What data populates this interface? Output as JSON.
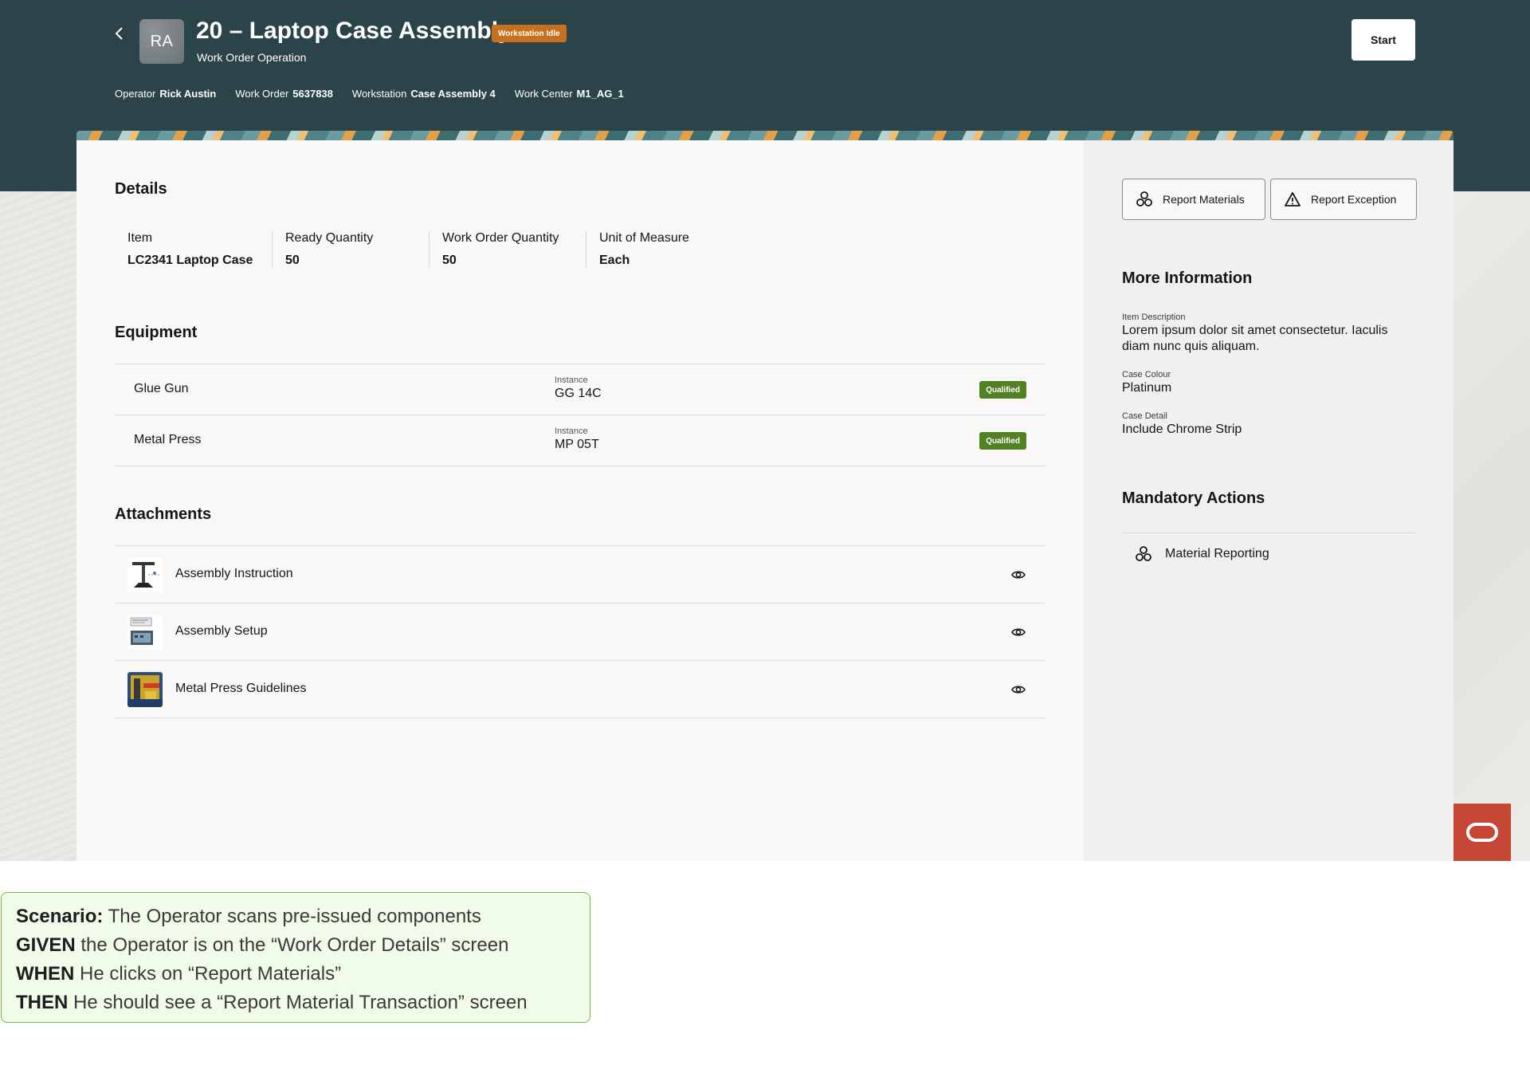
{
  "header": {
    "avatar_initials": "RA",
    "title": "20 – Laptop Case Assembly",
    "status_badge": "Workstation Idle",
    "subtitle": "Work Order Operation",
    "start_label": "Start",
    "meta": [
      {
        "label": "Operator",
        "value": "Rick Austin"
      },
      {
        "label": "Work Order",
        "value": "5637838"
      },
      {
        "label": "Workstation",
        "value": "Case Assembly 4"
      },
      {
        "label": "Work Center",
        "value": "M1_AG_1"
      }
    ]
  },
  "details": {
    "heading": "Details",
    "fields": [
      {
        "label": "Item",
        "value": "LC2341 Laptop Case"
      },
      {
        "label": "Ready Quantity",
        "value": "50"
      },
      {
        "label": "Work Order Quantity",
        "value": "50"
      },
      {
        "label": "Unit of Measure",
        "value": "Each"
      }
    ]
  },
  "equipment": {
    "heading": "Equipment",
    "instance_label": "Instance",
    "items": [
      {
        "name": "Glue Gun",
        "instance": "GG 14C",
        "status": "Qualified"
      },
      {
        "name": "Metal Press",
        "instance": "MP 05T",
        "status": "Qualified"
      }
    ]
  },
  "attachments": {
    "heading": "Attachments",
    "items": [
      {
        "name": "Assembly Instruction"
      },
      {
        "name": "Assembly Setup"
      },
      {
        "name": "Metal Press Guidelines"
      }
    ]
  },
  "actions": {
    "report_materials": "Report Materials",
    "report_exception": "Report Exception"
  },
  "more_info": {
    "heading": "More Information",
    "fields": [
      {
        "label": "Item Description",
        "value": "Lorem ipsum dolor sit amet consectetur. Iaculis diam nunc quis aliquam."
      },
      {
        "label": "Case Colour",
        "value": "Platinum"
      },
      {
        "label": "Case Detail",
        "value": "Include Chrome Strip"
      }
    ]
  },
  "mandatory": {
    "heading": "Mandatory Actions",
    "items": [
      {
        "label": "Material Reporting"
      }
    ]
  },
  "scenario": {
    "scenario_kw": "Scenario:",
    "scenario_text": " The Operator scans pre-issued components",
    "given_kw": "GIVEN",
    "given_text": " the Operator is on the “Work Order Details” screen",
    "when_kw": "WHEN",
    "when_text": " He clicks on “Report Materials”",
    "then_kw": "THEN",
    "then_text": " He should see a “Report Material Transaction” screen"
  },
  "colors": {
    "header_bg": "#2b4449",
    "badge_idle": "#c7711e",
    "badge_qualified": "#508223",
    "oracle_red": "#c74634",
    "scenario_border": "#7cb34a"
  }
}
